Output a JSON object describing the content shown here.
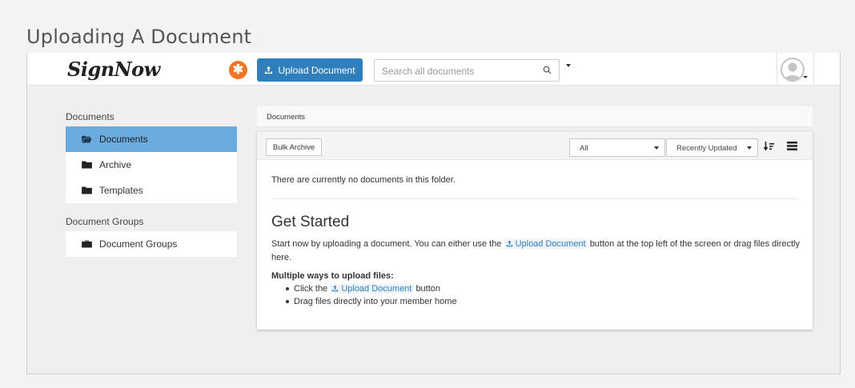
{
  "page_heading": "Uploading A Document",
  "header": {
    "logo_text": "SignNow",
    "logo_badge": "✱",
    "upload_button": "Upload Document",
    "search_placeholder": "Search all documents"
  },
  "sidebar": {
    "documents_heading": "Documents",
    "documents_items": [
      {
        "label": "Documents",
        "icon": "folder-open-icon",
        "active": true
      },
      {
        "label": "Archive",
        "icon": "folder-icon",
        "active": false
      },
      {
        "label": "Templates",
        "icon": "folder-icon",
        "active": false
      }
    ],
    "groups_heading": "Document Groups",
    "groups_items": [
      {
        "label": "Document Groups",
        "icon": "briefcase-icon",
        "active": false
      }
    ]
  },
  "breadcrumb": "Documents",
  "toolbar": {
    "bulk_archive": "Bulk Archive",
    "filter_value": "All",
    "sort_value": "Recently Updated"
  },
  "content": {
    "empty_message": "There are currently no documents in this folder.",
    "get_started_title": "Get Started",
    "intro_before": "Start now by uploading a document. You can either use the",
    "intro_link": "Upload Document",
    "intro_after": "button at the top left of the screen or drag files directly here.",
    "ways_title": "Multiple ways to upload files:",
    "way1_before": "Click the",
    "way1_link": "Upload Document",
    "way1_after": "button",
    "way2": "Drag files directly into your member home"
  },
  "colors": {
    "accent": "#2f7fbd",
    "active_item": "#6aace0",
    "badge": "#ee7625"
  }
}
